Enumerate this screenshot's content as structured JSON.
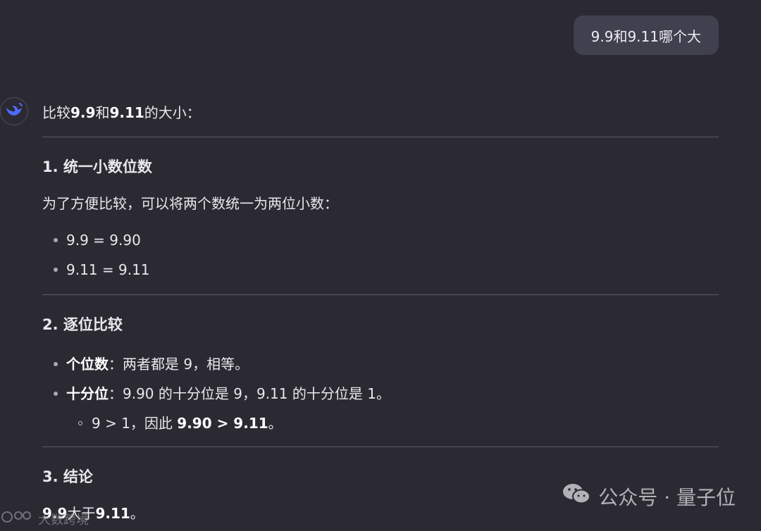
{
  "user_message": "9.9和9.11哪个大",
  "answer": {
    "intro_prefix": "比较 ",
    "intro_a": "9.9",
    "intro_mid": " 和 ",
    "intro_b": "9.11",
    "intro_suffix": " 的大小：",
    "section1": {
      "title": "1. 统一小数位数",
      "para": "为了方便比较，可以将两个数统一为两位小数：",
      "items": [
        "9.9 = 9.90",
        "9.11 = 9.11"
      ]
    },
    "section2": {
      "title": "2. 逐位比较",
      "item1_bold": "个位数",
      "item1_rest": "：两者都是 9，相等。",
      "item2_bold": "十分位",
      "item2_rest": "：9.90 的十分位是 9，9.11 的十分位是 1。",
      "sub_prefix": "9 > 1，因此 ",
      "sub_bold": "9.90 > 9.11",
      "sub_suffix": "。"
    },
    "section3": {
      "title": "3. 结论",
      "conclusion_a": "9.9",
      "conclusion_mid": " 大于 ",
      "conclusion_b": "9.11",
      "conclusion_suffix": "。"
    }
  },
  "watermark": {
    "text": "公众号 · 量子位",
    "left_text": "大数跨境"
  },
  "colors": {
    "background": "#2b2a33",
    "user_bubble": "#41404f",
    "accent": "#4d6bfe"
  }
}
